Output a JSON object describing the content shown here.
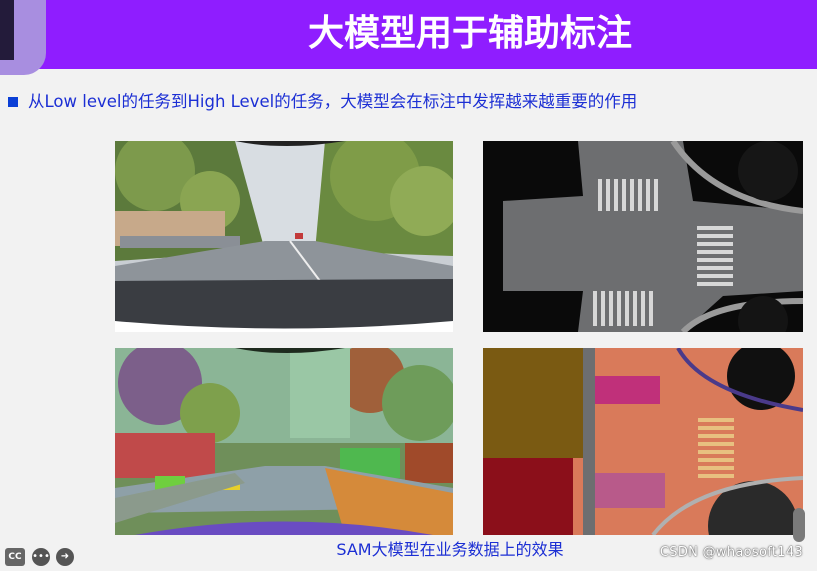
{
  "slide": {
    "title": "大模型用于辅助标注",
    "bullet": "从Low level的任务到High Level的任务，大模型会在标注中发挥越来越重要的作用",
    "caption": "SAM大模型在业务数据上的效果"
  },
  "images": [
    {
      "name": "road-camera-photo"
    },
    {
      "name": "intersection-bev-photo"
    },
    {
      "name": "road-camera-segmentation"
    },
    {
      "name": "intersection-bev-segmentation"
    }
  ],
  "watermark": "CSDN @whaosoft143",
  "controls": {
    "cc_label": "CC",
    "more_glyph": "•••",
    "next_glyph": "➜"
  },
  "colors": {
    "header_bg": "#8f1dff",
    "accent_text": "#1c2fd4"
  }
}
